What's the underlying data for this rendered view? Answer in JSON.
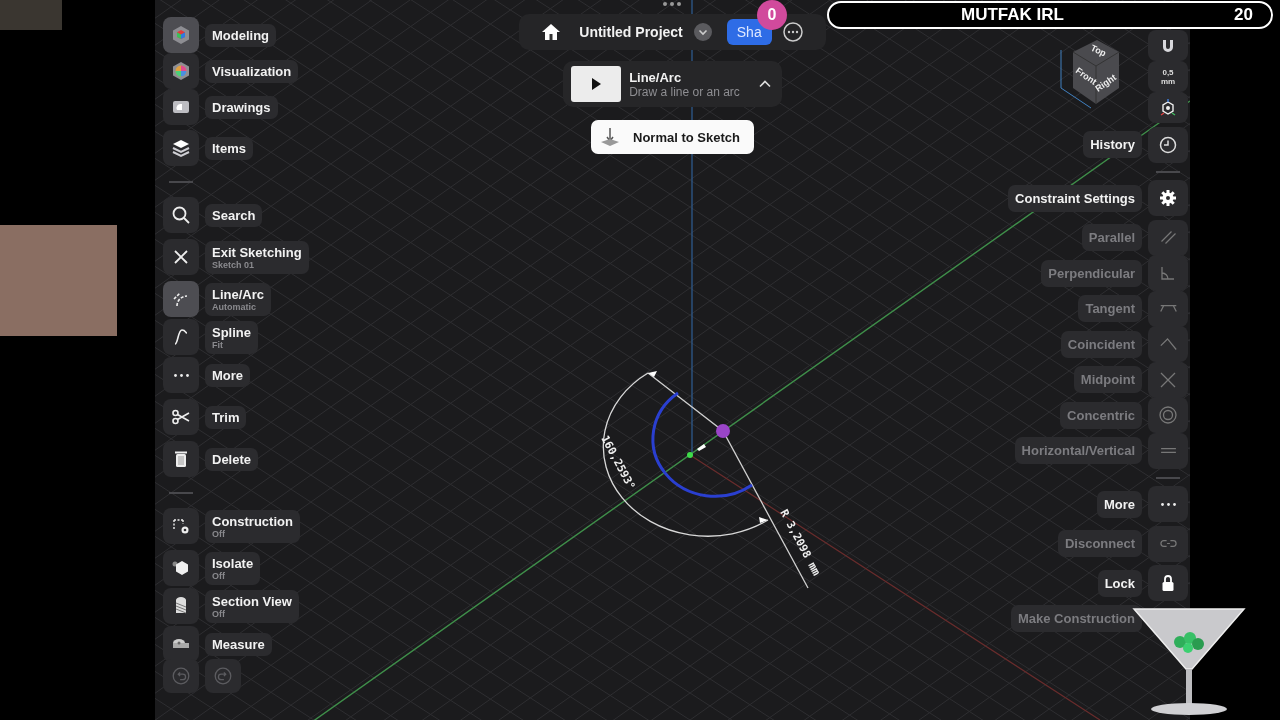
{
  "stream_overlay": {
    "counter": "0",
    "title": "MUTFAK IRL",
    "score": "20"
  },
  "top_bar": {
    "title": "Untitled Project",
    "share_button": "Sha"
  },
  "tool_card": {
    "title": "Line/Arc",
    "description": "Draw a line or an arc"
  },
  "normal_button": {
    "label": "Normal to Sketch"
  },
  "left_toolbar": {
    "sections": [
      {
        "groups": [
          {
            "items": [
              {
                "label": "Modeling",
                "selected": true
              },
              {
                "label": "Visualization",
                "selected": false
              },
              {
                "label": "Drawings",
                "selected": false
              }
            ]
          },
          {
            "items": [
              {
                "label": "Items",
                "selected": false
              }
            ]
          }
        ]
      },
      {
        "groups": [
          {
            "items": [
              {
                "label": "Search",
                "selected": false
              }
            ]
          },
          {
            "items": [
              {
                "label": "Exit Sketching",
                "sublabel": "Sketch 01",
                "selected": false
              }
            ]
          },
          {
            "items": [
              {
                "label": "Line/Arc",
                "sublabel": "Automatic",
                "selected": true
              },
              {
                "label": "Spline",
                "sublabel": "Fit",
                "selected": false
              },
              {
                "label": "More",
                "selected": false
              }
            ]
          },
          {
            "items": [
              {
                "label": "Trim",
                "selected": false
              }
            ]
          },
          {
            "items": [
              {
                "label": "Delete",
                "selected": false
              }
            ]
          }
        ]
      },
      {
        "groups": [
          {
            "items": [
              {
                "label": "Construction",
                "sublabel": "Off",
                "selected": false
              }
            ]
          },
          {
            "items": [
              {
                "label": "Isolate",
                "sublabel": "Off",
                "selected": false
              },
              {
                "label": "Section View",
                "sublabel": "Off",
                "selected": false
              },
              {
                "label": "Measure",
                "selected": false
              }
            ]
          }
        ]
      }
    ],
    "history_buttons": [
      {
        "disabled": true
      },
      {
        "disabled": true
      }
    ]
  },
  "view_cube": {
    "faces": [
      "Top",
      "Front",
      "Right"
    ]
  },
  "right_toolbar": {
    "sections": [
      {
        "groups": [
          {
            "items": [
              {
                "kind": "icon"
              },
              {
                "kind": "text",
                "value": "0,5",
                "unit": "mm"
              },
              {
                "kind": "icon"
              }
            ]
          },
          {
            "items": [
              {
                "kind": "icon",
                "label": "History",
                "disabled": false
              }
            ]
          }
        ]
      },
      {
        "groups": [
          {
            "items": [
              {
                "kind": "icon",
                "label": "Constraint Settings",
                "disabled": false
              }
            ]
          },
          {
            "items": [
              {
                "kind": "icon",
                "label": "Parallel",
                "disabled": true
              },
              {
                "kind": "icon",
                "label": "Perpendicular",
                "disabled": true
              },
              {
                "kind": "icon",
                "label": "Tangent",
                "disabled": true
              },
              {
                "kind": "icon",
                "label": "Coincident",
                "disabled": true
              },
              {
                "kind": "icon",
                "label": "Midpoint",
                "disabled": true
              },
              {
                "kind": "icon",
                "label": "Concentric",
                "disabled": true
              },
              {
                "kind": "icon",
                "label": "Horizontal/Vertical",
                "disabled": true
              }
            ]
          }
        ]
      },
      {
        "groups": [
          {
            "items": [
              {
                "kind": "icon",
                "label": "More",
                "disabled": false
              }
            ]
          },
          {
            "items": [
              {
                "kind": "icon",
                "label": "Disconnect",
                "disabled": true
              }
            ]
          },
          {
            "items": [
              {
                "kind": "icon",
                "label": "Lock",
                "disabled": false
              },
              {
                "kind": "blank",
                "label": "Make Construction",
                "disabled": true
              }
            ]
          }
        ]
      }
    ]
  },
  "sketch": {
    "angle_label": "160,2593°",
    "radius_label": "R 3,2098 mm"
  }
}
